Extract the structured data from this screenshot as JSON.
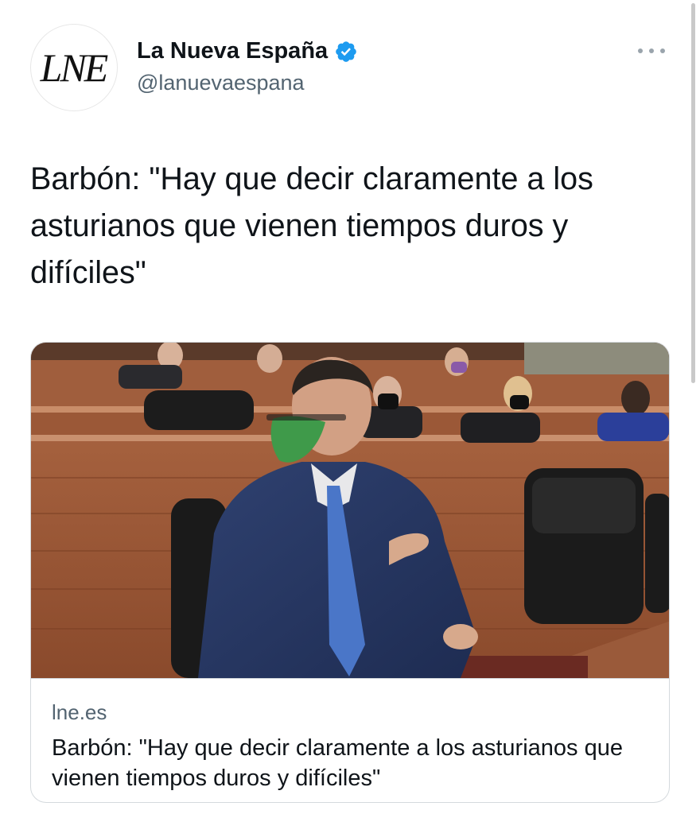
{
  "account": {
    "avatar_text": "LNE",
    "display_name": "La Nueva España",
    "handle": "@lanuevaespana",
    "verified": true,
    "verified_color": "#1d9bf0"
  },
  "tweet": {
    "text": "Barbón: \"Hay que decir claramente a los asturianos que vienen tiempos duros y difíciles\""
  },
  "card": {
    "domain": "lne.es",
    "title": "Barbón: \"Hay que decir claramente a los asturianos que vienen tiempos duros y difíciles\"",
    "image_subject": "man in suit with green face mask pointing in a parliament chamber"
  },
  "icons": {
    "more": "more-horizontal-icon",
    "verified": "verified-badge-icon"
  }
}
